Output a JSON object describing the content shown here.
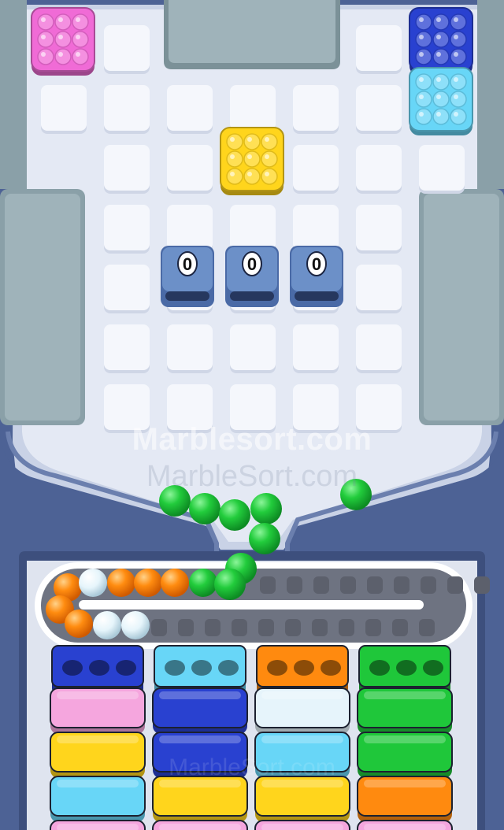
{
  "watermark": {
    "primary": "Marblesort.com",
    "secondary": "MarbleSort.com",
    "tertiary": "MarbleSort.com"
  },
  "board": {
    "cols": 7,
    "rows": 7
  },
  "colors": {
    "background": "#4d6295",
    "board": "#e4e9f4",
    "tile": "#f5f7fc",
    "wall": "#8aa0a8",
    "tray": "#eef1f7",
    "green": "#1fc73a",
    "orange": "#ff8a0f",
    "white": "#e6f4fb",
    "pink": "#f5a6de",
    "blue": "#2941d0",
    "light_blue": "#68d6f7",
    "yellow": "#ffd51c",
    "magenta": "#f06bd6"
  },
  "blocks": [
    {
      "color": "magenta",
      "col": 0,
      "row": 0
    },
    {
      "color": "yellow",
      "col": 3,
      "row": 2
    },
    {
      "color": "blue",
      "col": 6,
      "row": 0
    },
    {
      "color": "light_blue",
      "col": 6,
      "row": 1
    }
  ],
  "counters": [
    {
      "value": "0"
    },
    {
      "value": "0"
    },
    {
      "value": "0"
    }
  ],
  "conveyor": {
    "marbles": [
      "orange",
      "white",
      "orange",
      "orange",
      "orange",
      "green",
      "green",
      "orange",
      "orange",
      "white",
      "white"
    ],
    "falling_marbles": 8
  },
  "columns": [
    {
      "cap": "blue",
      "stack": [
        "pink",
        "yellow",
        "light_blue",
        "pink"
      ]
    },
    {
      "cap": "light_blue",
      "stack": [
        "blue",
        "blue",
        "yellow",
        "pink"
      ]
    },
    {
      "cap": "orange",
      "stack": [
        "white",
        "light_blue",
        "yellow",
        "pink"
      ]
    },
    {
      "cap": "green",
      "stack": [
        "green",
        "green",
        "orange",
        "pink"
      ]
    }
  ]
}
